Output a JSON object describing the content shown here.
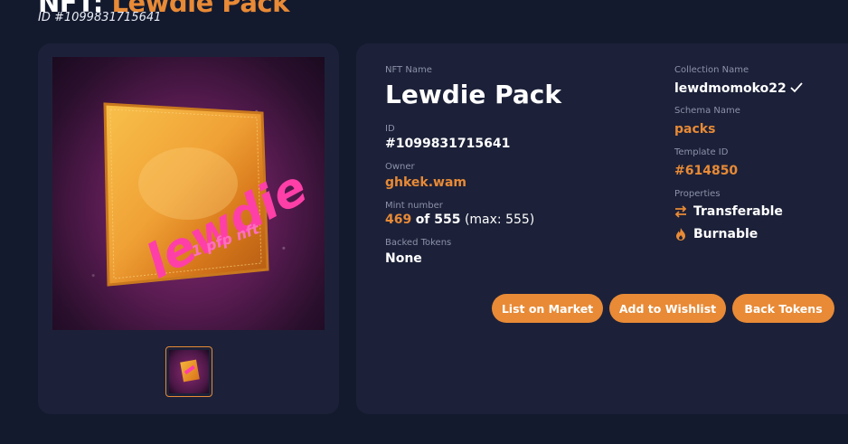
{
  "header": {
    "prefix": "NFT:",
    "title": "Lewdie Pack",
    "id_line": "ID #1099831715641"
  },
  "image": {
    "brand_text": "lewdie",
    "sub_text": "1 pfp nft"
  },
  "details": {
    "nft_name_label": "NFT Name",
    "nft_name": "Lewdie Pack",
    "id_label": "ID",
    "id_value": "#1099831715641",
    "owner_label": "Owner",
    "owner_value": "ghkek.wam",
    "mint_label": "Mint number",
    "mint_number": "469",
    "mint_of": "of 555",
    "mint_max": "(max: 555)",
    "backed_label": "Backed Tokens",
    "backed_value": "None",
    "collection_label": "Collection Name",
    "collection_value": "lewdmomoko22",
    "schema_label": "Schema Name",
    "schema_value": "packs",
    "template_label": "Template ID",
    "template_value": "#614850",
    "properties_label": "Properties",
    "properties": [
      {
        "label": "Transferable",
        "icon": "transfer-arrows-icon"
      },
      {
        "label": "Burnable",
        "icon": "flame-icon"
      }
    ]
  },
  "actions": {
    "list_market": "List on Market",
    "add_wishlist": "Add to Wishlist",
    "back_tokens": "Back Tokens"
  },
  "colors": {
    "background": "#141a2e",
    "card": "#1c2139",
    "accent": "#e88a36",
    "muted": "#8c92a8"
  }
}
